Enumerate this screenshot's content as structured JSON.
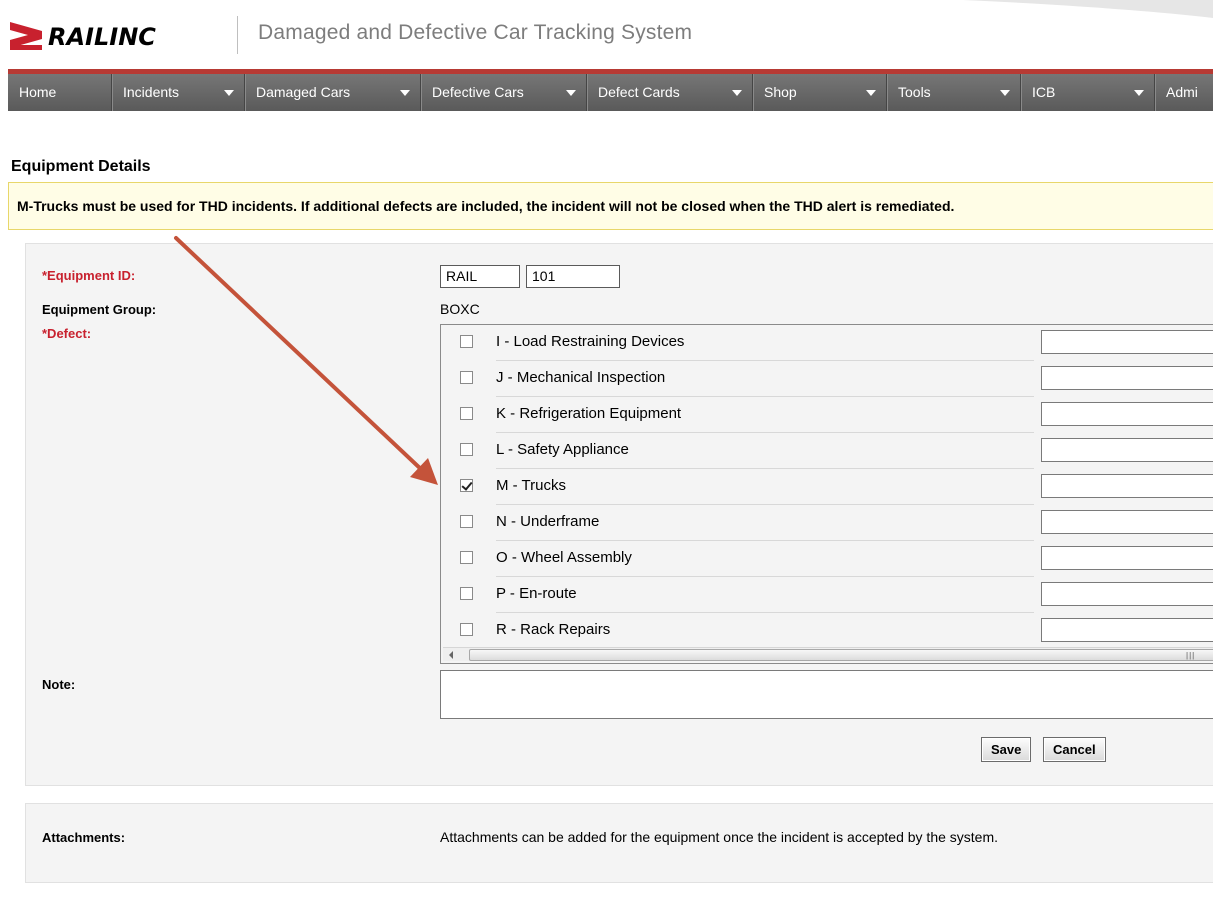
{
  "header": {
    "brand": "RAILINC",
    "app_title": "Damaged and Defective Car Tracking System"
  },
  "nav": [
    {
      "label": "Home",
      "dropdown": false
    },
    {
      "label": "Incidents",
      "dropdown": true
    },
    {
      "label": "Damaged Cars",
      "dropdown": true
    },
    {
      "label": "Defective Cars",
      "dropdown": true
    },
    {
      "label": "Defect Cards",
      "dropdown": true
    },
    {
      "label": "Shop",
      "dropdown": true
    },
    {
      "label": "Tools",
      "dropdown": true
    },
    {
      "label": "ICB",
      "dropdown": true
    },
    {
      "label": "Admi",
      "dropdown": false
    }
  ],
  "section_title": "Equipment Details",
  "alert": "M-Trucks must be used for THD incidents. If additional defects are included, the incident will not be closed when the THD alert is remediated.",
  "form": {
    "equipment_id_label": "*Equipment ID:",
    "equipment_initial": "RAIL",
    "equipment_number": "101",
    "equipment_group_label": "Equipment Group:",
    "equipment_group": "BOXC",
    "defect_label": "*Defect:",
    "note_label": "Note:",
    "note_value": "",
    "save_label": "Save",
    "cancel_label": "Cancel"
  },
  "defects": [
    {
      "label": "I - Load Restraining Devices",
      "checked": false
    },
    {
      "label": "J - Mechanical Inspection",
      "checked": false
    },
    {
      "label": "K - Refrigeration Equipment",
      "checked": false
    },
    {
      "label": "L - Safety Appliance",
      "checked": false
    },
    {
      "label": "M - Trucks",
      "checked": true
    },
    {
      "label": "N - Underframe",
      "checked": false
    },
    {
      "label": "O - Wheel Assembly",
      "checked": false
    },
    {
      "label": "P - En-route",
      "checked": false
    },
    {
      "label": "R - Rack Repairs",
      "checked": false
    }
  ],
  "attachments": {
    "label": "Attachments:",
    "text": "Attachments can be added for the equipment once the incident is accepted by the system."
  },
  "colors": {
    "accent_red": "#b73a34",
    "required_red": "#c8212e",
    "nav_gray": "#636363",
    "alert_bg": "#fffde6"
  }
}
